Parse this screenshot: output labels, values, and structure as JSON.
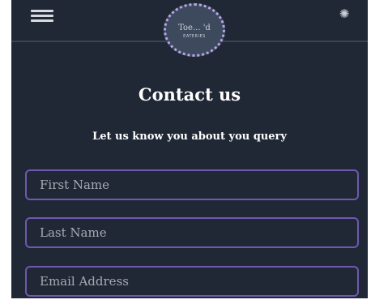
{
  "header": {
    "menu_icon": "hamburger-menu-icon",
    "settings_icon": "gear-icon",
    "logo": {
      "name": "Toe... 'd",
      "subtitle": "EATERIES",
      "accent_color": "#b9a6e4"
    }
  },
  "page": {
    "title": "Contact us",
    "subtitle": "Let us know you about you query"
  },
  "form": {
    "first_name": {
      "placeholder": "First Name",
      "value": ""
    },
    "last_name": {
      "placeholder": "Last Name",
      "value": ""
    },
    "email": {
      "placeholder": "Email Address",
      "value": ""
    }
  },
  "colors": {
    "background": "#202836",
    "field_border": "#6e58b0",
    "text": "#ffffff"
  }
}
